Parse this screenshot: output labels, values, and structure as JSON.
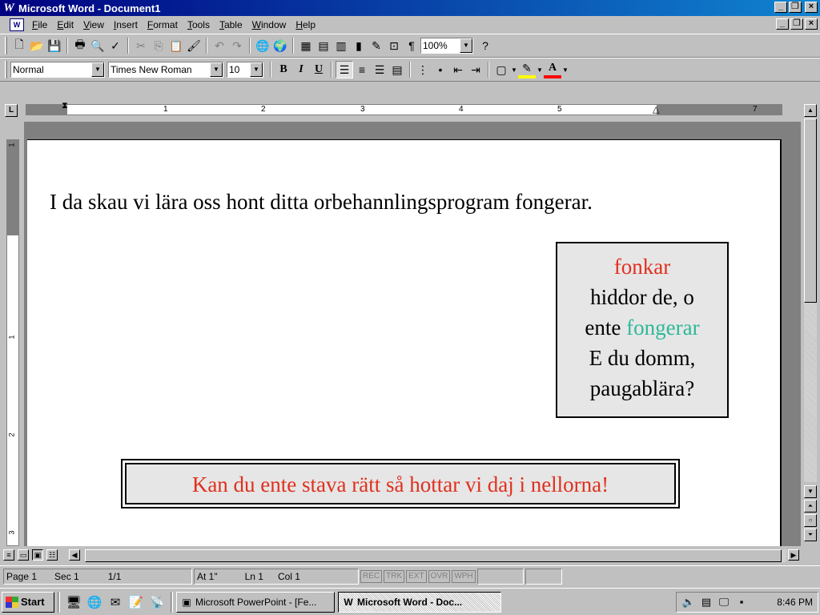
{
  "window": {
    "title": "Microsoft Word - Document1",
    "app_icon": "word-icon"
  },
  "menubar": {
    "items": [
      "File",
      "Edit",
      "View",
      "Insert",
      "Format",
      "Tools",
      "Table",
      "Window",
      "Help"
    ]
  },
  "standard_toolbar": {
    "zoom": "100%",
    "buttons": [
      "new-document",
      "open",
      "save",
      "print",
      "print-preview",
      "spelling",
      "cut",
      "copy",
      "paste",
      "format-painter",
      "undo",
      "redo",
      "insert-hyperlink",
      "web-toolbar",
      "tables-and-borders",
      "insert-table",
      "insert-excel-worksheet",
      "columns",
      "drawing",
      "document-map",
      "show-hide-paragraph",
      "help"
    ]
  },
  "formatting_toolbar": {
    "style": "Normal",
    "font": "Times New Roman",
    "size": "10",
    "bold_label": "B",
    "italic_label": "I",
    "underline_label": "U",
    "underline_color": "#ff0000",
    "highlight_color": "#ffff00"
  },
  "ruler": {
    "numbers": [
      "1",
      "2",
      "3",
      "4",
      "5",
      "7"
    ]
  },
  "vertical_ruler": {
    "numbers": [
      "1",
      "1",
      "2",
      "3"
    ]
  },
  "document": {
    "line1": "I da skau vi lära oss hont ditta orbehannlingsprogram fongerar.",
    "box1": {
      "line1": "fonkar",
      "line2": "hiddor de, o",
      "line3_prefix": "ente ",
      "line3_colored": "fongerar",
      "line4": "E du domm,",
      "line5": "paugablära?"
    },
    "box2_text": "Kan du ente stava rätt så hottar vi daj i nellorna!",
    "colors": {
      "red_text": "#e0301e",
      "teal_text": "#2fb89a",
      "box_fill": "#e6e6e6"
    }
  },
  "statusbar": {
    "page": "Page 1",
    "sec": "Sec 1",
    "pages": "1/1",
    "at": "At 1\"",
    "ln": "Ln 1",
    "col": "Col 1",
    "modes": [
      "REC",
      "TRK",
      "EXT",
      "OVR",
      "WPH"
    ]
  },
  "taskbar": {
    "start_label": "Start",
    "tasks": [
      {
        "label": "Microsoft PowerPoint - [Fe...",
        "active": false
      },
      {
        "label": "Microsoft Word - Doc...",
        "active": true
      }
    ],
    "clock": "8:46 PM"
  }
}
